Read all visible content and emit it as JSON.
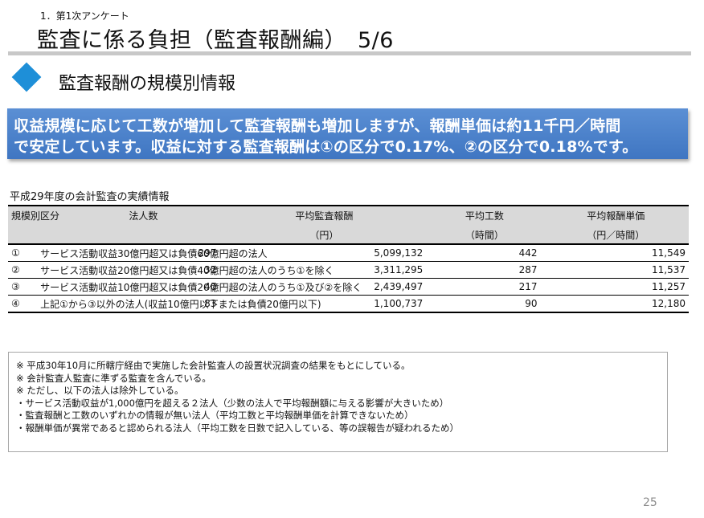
{
  "header": {
    "section_label": "1．第1次アンケート",
    "title": "監査に係る負担（監査報酬編）　5/6",
    "subtitle": "監査報酬の規模別情報"
  },
  "banner": {
    "line1": "収益規模に応じて工数が増加して監査報酬も増加しますが、報酬単価は約11千円／時間",
    "line2": "で安定しています。収益に対する監査報酬は①の区分で0.17%、②の区分で0.18%です。"
  },
  "table": {
    "caption": "平成29年度の会計監査の実績情報",
    "headers": {
      "category": "規模別区分",
      "count": "法人数",
      "avg_fee": "平均監査報酬",
      "avg_fee_unit": "（円）",
      "avg_hours": "平均工数",
      "avg_hours_unit": "（時間）",
      "unit_fee": "平均報酬単価",
      "unit_fee_unit": "（円／時間）"
    },
    "rows": [
      {
        "no": "①",
        "name": "サービス活動収益30億円超又は負債60億円超の法人",
        "count": "297",
        "avg_fee": "5,099,132",
        "avg_hours": "442",
        "unit_fee": "11,549"
      },
      {
        "no": "②",
        "name": "サービス活動収益20億円超又は負債40億円超の法人のうち①を除く",
        "count": "32",
        "avg_fee": "3,311,295",
        "avg_hours": "287",
        "unit_fee": "11,537"
      },
      {
        "no": "③",
        "name": "サービス活動収益10億円超又は負債20億円超の法人のうち①及び②を除く",
        "count": "40",
        "avg_fee": "2,439,497",
        "avg_hours": "217",
        "unit_fee": "11,257"
      },
      {
        "no": "④",
        "name": "上記①から③以外の法人(収益10億円以下または負債20億円以下)",
        "count": "83",
        "avg_fee": "1,100,737",
        "avg_hours": "90",
        "unit_fee": "12,180"
      }
    ]
  },
  "notes": [
    "※ 平成30年10月に所轄庁経由で実施した会計監査人の設置状況調査の結果をもとにしている。",
    "※ 会計監査人監査に準ずる監査を含んでいる。",
    "※ ただし、以下の法人は除外している。",
    "・サービス活動収益が1,000億円を超える２法人（少数の法人で平均報酬額に与える影響が大きいため）",
    "・監査報酬と工数のいずれかの情報が無い法人（平均工数と平均報酬単価を計算できないため）",
    "・報酬単価が異常であると認められる法人（平均工数を日数で記入している、等の誤報告が疑われるため）"
  ],
  "page_number": "25",
  "colors": {
    "accent_diamond": "#1e8fd8",
    "banner_bg": "#4a80c9",
    "table_header_bg": "#d9d9d9"
  }
}
